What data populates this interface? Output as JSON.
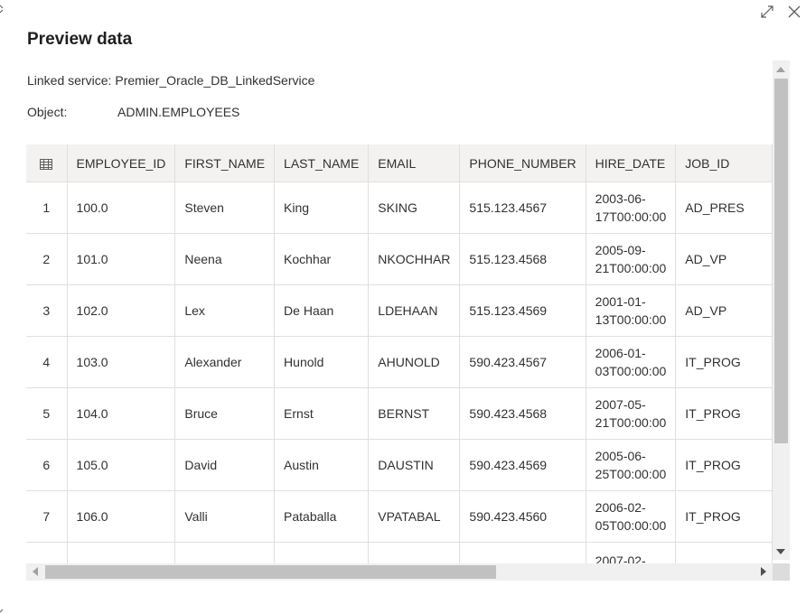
{
  "dialog": {
    "title": "Preview data",
    "linked_service_label": "Linked service:",
    "linked_service_value": "Premier_Oracle_DB_LinkedService",
    "object_label": "Object:",
    "object_value": "ADMIN.EMPLOYEES",
    "icons": [
      "expand-icon",
      "close-icon",
      "grid-icon"
    ]
  },
  "table": {
    "columns": [
      "EMPLOYEE_ID",
      "FIRST_NAME",
      "LAST_NAME",
      "EMAIL",
      "PHONE_NUMBER",
      "HIRE_DATE",
      "JOB_ID"
    ],
    "rows": [
      [
        "1",
        "100.0",
        "Steven",
        "King",
        "SKING",
        "515.123.4567",
        "2003-06-17T00:00:00",
        "AD_PRES"
      ],
      [
        "2",
        "101.0",
        "Neena",
        "Kochhar",
        "NKOCHHAR",
        "515.123.4568",
        "2005-09-21T00:00:00",
        "AD_VP"
      ],
      [
        "3",
        "102.0",
        "Lex",
        "De Haan",
        "LDEHAAN",
        "515.123.4569",
        "2001-01-13T00:00:00",
        "AD_VP"
      ],
      [
        "4",
        "103.0",
        "Alexander",
        "Hunold",
        "AHUNOLD",
        "590.423.4567",
        "2006-01-03T00:00:00",
        "IT_PROG"
      ],
      [
        "5",
        "104.0",
        "Bruce",
        "Ernst",
        "BERNST",
        "590.423.4568",
        "2007-05-21T00:00:00",
        "IT_PROG"
      ],
      [
        "6",
        "105.0",
        "David",
        "Austin",
        "DAUSTIN",
        "590.423.4569",
        "2005-06-25T00:00:00",
        "IT_PROG"
      ],
      [
        "7",
        "106.0",
        "Valli",
        "Pataballa",
        "VPATABAL",
        "590.423.4560",
        "2006-02-05T00:00:00",
        "IT_PROG"
      ],
      [
        "",
        "",
        "",
        "",
        "",
        "",
        "2007-02-",
        ""
      ]
    ]
  },
  "scroll": {
    "vertical_position": 0.0,
    "horizontal_position": 0.0
  }
}
